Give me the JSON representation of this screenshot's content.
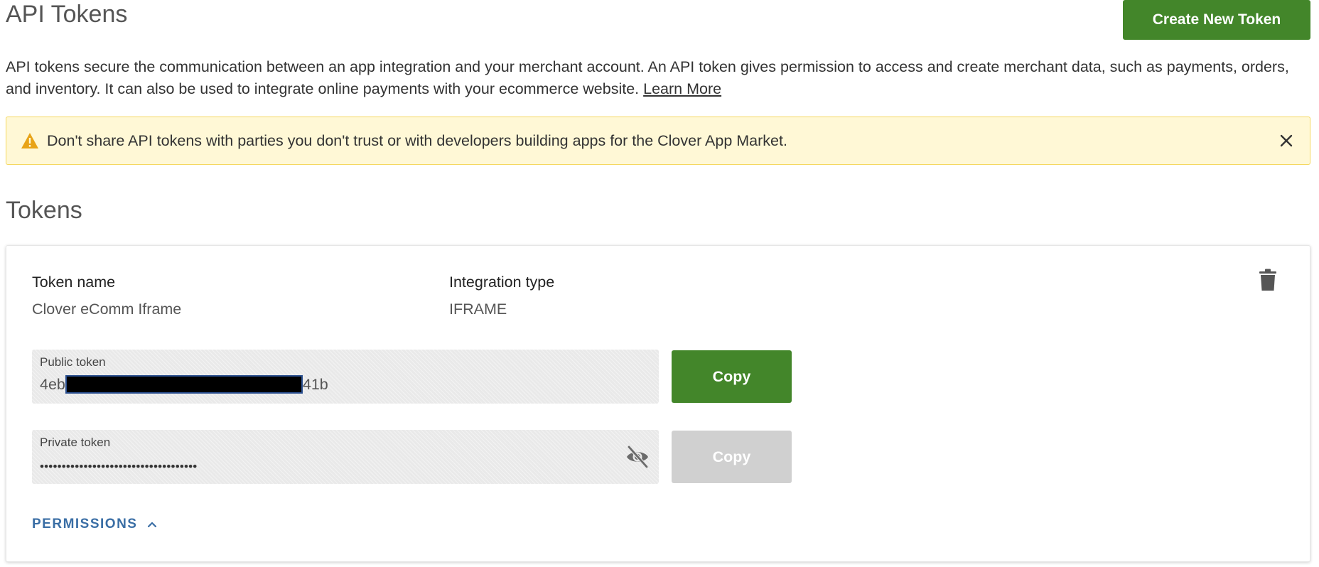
{
  "header": {
    "title": "API Tokens",
    "create_button_label": "Create New Token"
  },
  "intro": {
    "text": "API tokens secure the communication between an app integration and your merchant account. An API token gives permission to access and create merchant data, such as payments, orders, and inventory. It can also be used to integrate online payments with your ecommerce website.",
    "learn_more_label": "Learn More"
  },
  "warning": {
    "icon": "warning-triangle-icon",
    "text": "Don't share API tokens with parties you don't trust or with developers building apps for the Clover App Market.",
    "close_icon": "close-icon"
  },
  "tokens_section": {
    "title": "Tokens"
  },
  "token_card": {
    "name_label": "Token name",
    "name_value": "Clover eComm Iframe",
    "integration_label": "Integration type",
    "integration_value": "IFRAME",
    "delete_icon": "trash-icon",
    "public_token": {
      "label": "Public token",
      "value_prefix": "4eb",
      "value_suffix": "41b",
      "copy_label": "Copy"
    },
    "private_token": {
      "label": "Private token",
      "masked_value": "••••••••••••••••••••••••••••••••••••",
      "visibility_icon": "eye-off-icon",
      "copy_label": "Copy"
    },
    "permissions_label": "PERMISSIONS",
    "permissions_icon": "chevron-up-icon"
  },
  "colors": {
    "primary_green": "#43862a",
    "disabled_gray": "#d0d0d0",
    "warning_bg": "#fff8d6",
    "warning_border": "#f5d85f",
    "warning_icon": "#e8a317",
    "link_blue": "#3a6ea5"
  }
}
